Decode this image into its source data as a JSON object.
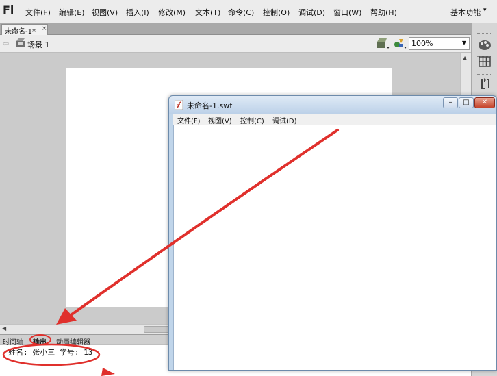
{
  "app": {
    "logo": "Fl",
    "menu": [
      {
        "id": "file",
        "label": "文件(F)"
      },
      {
        "id": "edit",
        "label": "编辑(E)"
      },
      {
        "id": "view",
        "label": "视图(V)"
      },
      {
        "id": "insert",
        "label": "插入(I)"
      },
      {
        "id": "modify",
        "label": "修改(M)"
      },
      {
        "id": "text",
        "label": "文本(T)"
      },
      {
        "id": "commands",
        "label": "命令(C)"
      },
      {
        "id": "control",
        "label": "控制(O)"
      },
      {
        "id": "debug",
        "label": "调试(D)"
      },
      {
        "id": "window",
        "label": "窗口(W)"
      },
      {
        "id": "help",
        "label": "帮助(H)"
      }
    ],
    "workspace": "基本功能",
    "workspace_caret": "▾"
  },
  "document": {
    "tab_label": "未命名-1*",
    "tab_close": "×",
    "collapse": "◂◂"
  },
  "editbar": {
    "back": "⇦",
    "scene_label": "场景 1",
    "zoom": "100%",
    "zoom_caret": "▼"
  },
  "scrollbars": {
    "up": "▲",
    "left": "◀"
  },
  "panel": {
    "tabs": [
      {
        "id": "timeline",
        "label": "时间轴",
        "active": false
      },
      {
        "id": "output",
        "label": "输出",
        "active": true
      },
      {
        "id": "motion-editor",
        "label": "动画编辑器",
        "active": false
      }
    ],
    "output_text": "姓名: 张小三 学号: 13"
  },
  "swf_window": {
    "title": "未命名-1.swf",
    "minimize": "–",
    "maximize": "□",
    "close": "✕",
    "menu": [
      {
        "id": "file",
        "label": "文件(F)"
      },
      {
        "id": "view",
        "label": "视图(V)"
      },
      {
        "id": "control",
        "label": "控制(C)"
      },
      {
        "id": "debug",
        "label": "调试(D)"
      }
    ]
  },
  "colors": {
    "annotation": "#e0302c"
  }
}
